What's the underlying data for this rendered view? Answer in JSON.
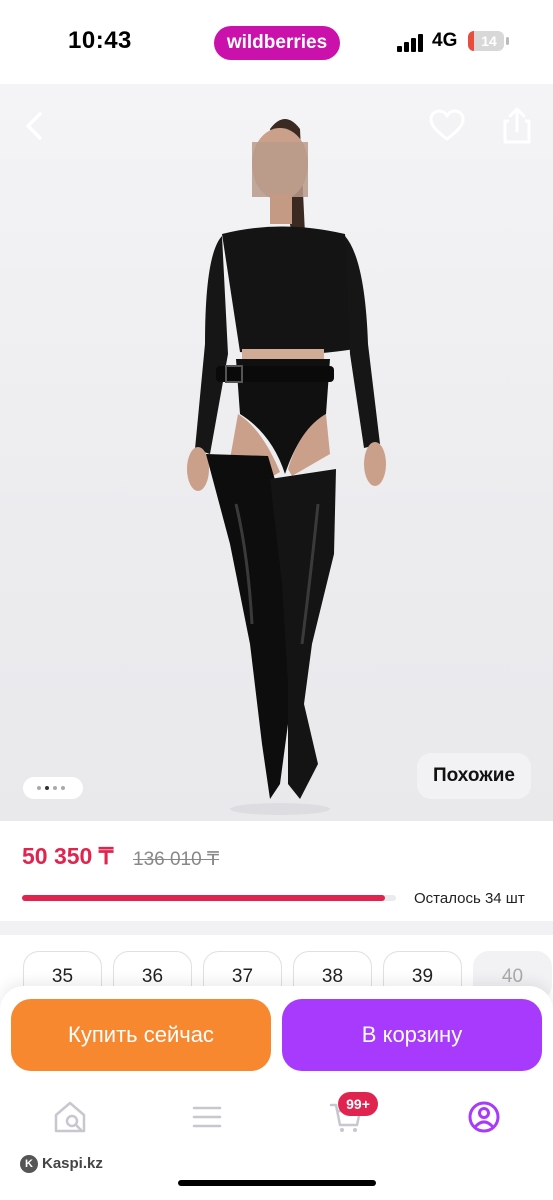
{
  "status": {
    "time": "10:43",
    "network": "4G",
    "battery": "14"
  },
  "brand": {
    "name": "wildberries"
  },
  "icons": {
    "back": "chevron-left-icon",
    "favorite": "heart-icon",
    "share": "share-icon",
    "home": "home-search-icon",
    "catalog": "menu-icon",
    "cart": "cart-icon",
    "profile": "profile-icon"
  },
  "gallery": {
    "similar_label": "Похожие",
    "dots_count": 4,
    "active_dot": 1
  },
  "price": {
    "current": "50 350 ₸",
    "old": "136 010 ₸",
    "stock_text": "Осталось 34 шт",
    "stock_fraction": 0.97
  },
  "sizes": [
    "35",
    "36",
    "37",
    "38",
    "39",
    "40"
  ],
  "actions": {
    "buy_now": "Купить сейчас",
    "add_to_cart": "В корзину"
  },
  "nav": {
    "cart_badge": "99+"
  },
  "watermark": {
    "text": "Kaspi.kz"
  },
  "colors": {
    "brand": "#cb11ab",
    "price": "#e0244f",
    "buy_button": "#f7882f",
    "cart_button": "#a73afd",
    "active_nav": "#a73afd"
  }
}
